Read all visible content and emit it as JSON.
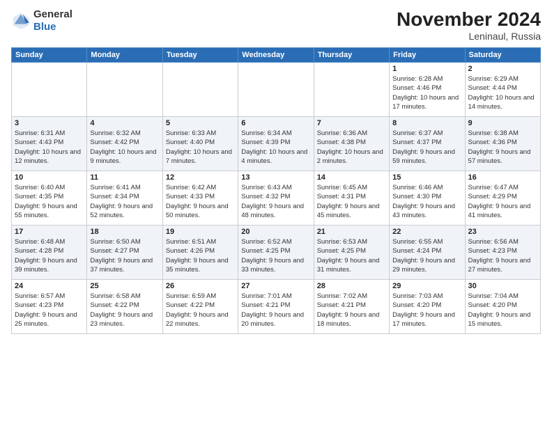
{
  "logo": {
    "general": "General",
    "blue": "Blue"
  },
  "header": {
    "month": "November 2024",
    "location": "Leninaul, Russia"
  },
  "weekdays": [
    "Sunday",
    "Monday",
    "Tuesday",
    "Wednesday",
    "Thursday",
    "Friday",
    "Saturday"
  ],
  "weeks": [
    [
      {
        "day": "",
        "info": ""
      },
      {
        "day": "",
        "info": ""
      },
      {
        "day": "",
        "info": ""
      },
      {
        "day": "",
        "info": ""
      },
      {
        "day": "",
        "info": ""
      },
      {
        "day": "1",
        "info": "Sunrise: 6:28 AM\nSunset: 4:46 PM\nDaylight: 10 hours and 17 minutes."
      },
      {
        "day": "2",
        "info": "Sunrise: 6:29 AM\nSunset: 4:44 PM\nDaylight: 10 hours and 14 minutes."
      }
    ],
    [
      {
        "day": "3",
        "info": "Sunrise: 6:31 AM\nSunset: 4:43 PM\nDaylight: 10 hours and 12 minutes."
      },
      {
        "day": "4",
        "info": "Sunrise: 6:32 AM\nSunset: 4:42 PM\nDaylight: 10 hours and 9 minutes."
      },
      {
        "day": "5",
        "info": "Sunrise: 6:33 AM\nSunset: 4:40 PM\nDaylight: 10 hours and 7 minutes."
      },
      {
        "day": "6",
        "info": "Sunrise: 6:34 AM\nSunset: 4:39 PM\nDaylight: 10 hours and 4 minutes."
      },
      {
        "day": "7",
        "info": "Sunrise: 6:36 AM\nSunset: 4:38 PM\nDaylight: 10 hours and 2 minutes."
      },
      {
        "day": "8",
        "info": "Sunrise: 6:37 AM\nSunset: 4:37 PM\nDaylight: 9 hours and 59 minutes."
      },
      {
        "day": "9",
        "info": "Sunrise: 6:38 AM\nSunset: 4:36 PM\nDaylight: 9 hours and 57 minutes."
      }
    ],
    [
      {
        "day": "10",
        "info": "Sunrise: 6:40 AM\nSunset: 4:35 PM\nDaylight: 9 hours and 55 minutes."
      },
      {
        "day": "11",
        "info": "Sunrise: 6:41 AM\nSunset: 4:34 PM\nDaylight: 9 hours and 52 minutes."
      },
      {
        "day": "12",
        "info": "Sunrise: 6:42 AM\nSunset: 4:33 PM\nDaylight: 9 hours and 50 minutes."
      },
      {
        "day": "13",
        "info": "Sunrise: 6:43 AM\nSunset: 4:32 PM\nDaylight: 9 hours and 48 minutes."
      },
      {
        "day": "14",
        "info": "Sunrise: 6:45 AM\nSunset: 4:31 PM\nDaylight: 9 hours and 45 minutes."
      },
      {
        "day": "15",
        "info": "Sunrise: 6:46 AM\nSunset: 4:30 PM\nDaylight: 9 hours and 43 minutes."
      },
      {
        "day": "16",
        "info": "Sunrise: 6:47 AM\nSunset: 4:29 PM\nDaylight: 9 hours and 41 minutes."
      }
    ],
    [
      {
        "day": "17",
        "info": "Sunrise: 6:48 AM\nSunset: 4:28 PM\nDaylight: 9 hours and 39 minutes."
      },
      {
        "day": "18",
        "info": "Sunrise: 6:50 AM\nSunset: 4:27 PM\nDaylight: 9 hours and 37 minutes."
      },
      {
        "day": "19",
        "info": "Sunrise: 6:51 AM\nSunset: 4:26 PM\nDaylight: 9 hours and 35 minutes."
      },
      {
        "day": "20",
        "info": "Sunrise: 6:52 AM\nSunset: 4:25 PM\nDaylight: 9 hours and 33 minutes."
      },
      {
        "day": "21",
        "info": "Sunrise: 6:53 AM\nSunset: 4:25 PM\nDaylight: 9 hours and 31 minutes."
      },
      {
        "day": "22",
        "info": "Sunrise: 6:55 AM\nSunset: 4:24 PM\nDaylight: 9 hours and 29 minutes."
      },
      {
        "day": "23",
        "info": "Sunrise: 6:56 AM\nSunset: 4:23 PM\nDaylight: 9 hours and 27 minutes."
      }
    ],
    [
      {
        "day": "24",
        "info": "Sunrise: 6:57 AM\nSunset: 4:23 PM\nDaylight: 9 hours and 25 minutes."
      },
      {
        "day": "25",
        "info": "Sunrise: 6:58 AM\nSunset: 4:22 PM\nDaylight: 9 hours and 23 minutes."
      },
      {
        "day": "26",
        "info": "Sunrise: 6:59 AM\nSunset: 4:22 PM\nDaylight: 9 hours and 22 minutes."
      },
      {
        "day": "27",
        "info": "Sunrise: 7:01 AM\nSunset: 4:21 PM\nDaylight: 9 hours and 20 minutes."
      },
      {
        "day": "28",
        "info": "Sunrise: 7:02 AM\nSunset: 4:21 PM\nDaylight: 9 hours and 18 minutes."
      },
      {
        "day": "29",
        "info": "Sunrise: 7:03 AM\nSunset: 4:20 PM\nDaylight: 9 hours and 17 minutes."
      },
      {
        "day": "30",
        "info": "Sunrise: 7:04 AM\nSunset: 4:20 PM\nDaylight: 9 hours and 15 minutes."
      }
    ]
  ]
}
